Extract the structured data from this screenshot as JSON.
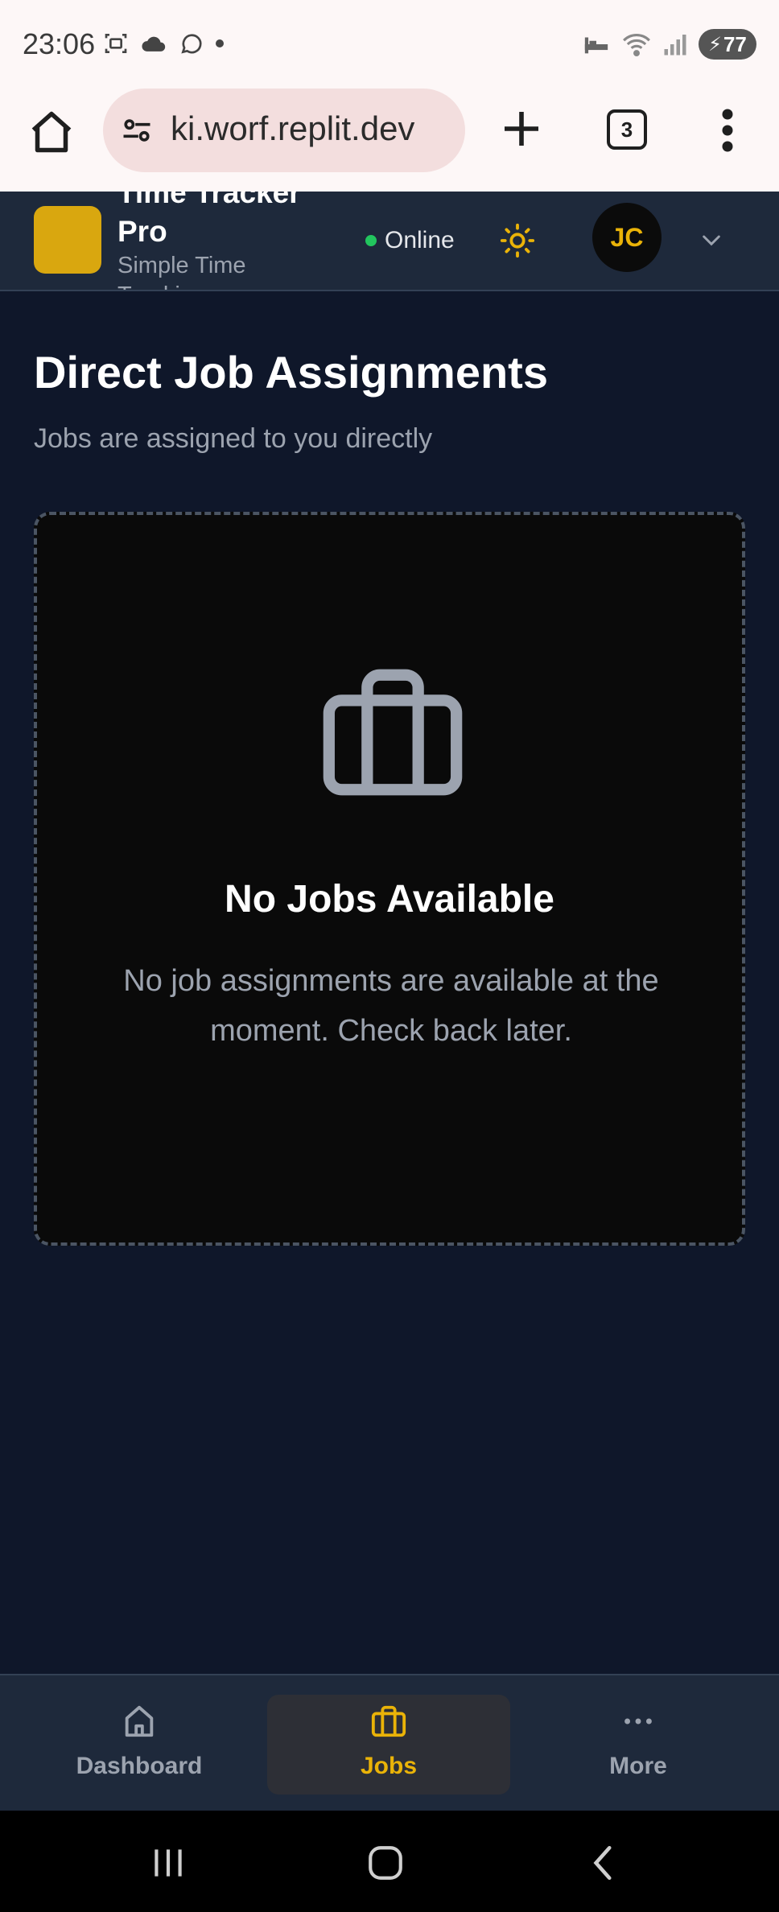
{
  "status_bar": {
    "time": "23:06",
    "battery": "77"
  },
  "browser": {
    "url": "ki.worf.replit.dev",
    "tab_count": "3"
  },
  "app": {
    "title": "Time Tracker Pro",
    "subtitle": "Simple Time Tracking",
    "status": "Online",
    "user_initials": "JC",
    "brand_color": "#d9a70f"
  },
  "page": {
    "title": "Direct Job Assignments",
    "subtitle": "Jobs are assigned to you directly"
  },
  "empty_state": {
    "icon": "briefcase-icon",
    "title": "No Jobs Available",
    "message": "No job assignments are available at the moment. Check back later."
  },
  "bottom_nav": {
    "items": [
      {
        "label": "Dashboard",
        "icon": "home-icon",
        "active": false
      },
      {
        "label": "Jobs",
        "icon": "briefcase-icon",
        "active": true
      },
      {
        "label": "More",
        "icon": "ellipsis-icon",
        "active": false
      }
    ]
  }
}
